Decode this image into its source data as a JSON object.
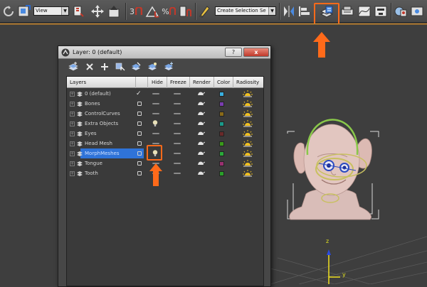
{
  "toolbar": {
    "reference_coordinate_system": "View",
    "selection_set_placeholder": "Create Selection Se",
    "snap_angle_label": "3",
    "percent_snap_label": "%",
    "icons": [
      "redo-icon",
      "select-and-move-icon",
      "select-and-rotate-icon",
      "snaps-toggle-icon",
      "angle-snap-icon",
      "percent-snap-icon",
      "spinner-snap-icon",
      "edit-named-selection-icon",
      "mirror-icon",
      "align-icon",
      "toggle-layer-explorer-icon",
      "manage-layers-icon",
      "render-setup-icon",
      "curve-editor-icon",
      "schematic-view-icon",
      "material-editor-icon"
    ]
  },
  "dialog": {
    "title": "Layer: 0 (default)",
    "help_label": "?",
    "close_label": "x",
    "tools": [
      "create-new-layer-icon",
      "delete-layer-icon",
      "add-to-layer-icon",
      "select-objects-in-layer-icon",
      "highlight-selected-layer-icon",
      "hide-unhide-all-icon",
      "freeze-unfreeze-all-icon"
    ],
    "columns": [
      "Layers",
      "Hide",
      "Freeze",
      "Render",
      "Color",
      "Radiosity"
    ],
    "layers": [
      {
        "name": "0 (default)",
        "active_check": "✓",
        "color": "#3ab0e0"
      },
      {
        "name": "Bones",
        "color": "#7a3db0"
      },
      {
        "name": "ControlCurves",
        "color": "#8a6a18"
      },
      {
        "name": "Extra Objects",
        "color": "#1a9a8a"
      },
      {
        "name": "Eyes",
        "color": "#6a2a2a"
      },
      {
        "name": "Head Mesh",
        "color": "#3a9a1a"
      },
      {
        "name": "MorphMeshes",
        "color": "#2aaa3a",
        "selected": true
      },
      {
        "name": "Tongue",
        "color": "#9a3070"
      },
      {
        "name": "Tooth",
        "color": "#2aa02a"
      }
    ]
  },
  "viewport": {
    "axis_z_label": "z",
    "axis_y_label": "y"
  },
  "annotations": {
    "highlight_color": "#ff6a1a"
  }
}
